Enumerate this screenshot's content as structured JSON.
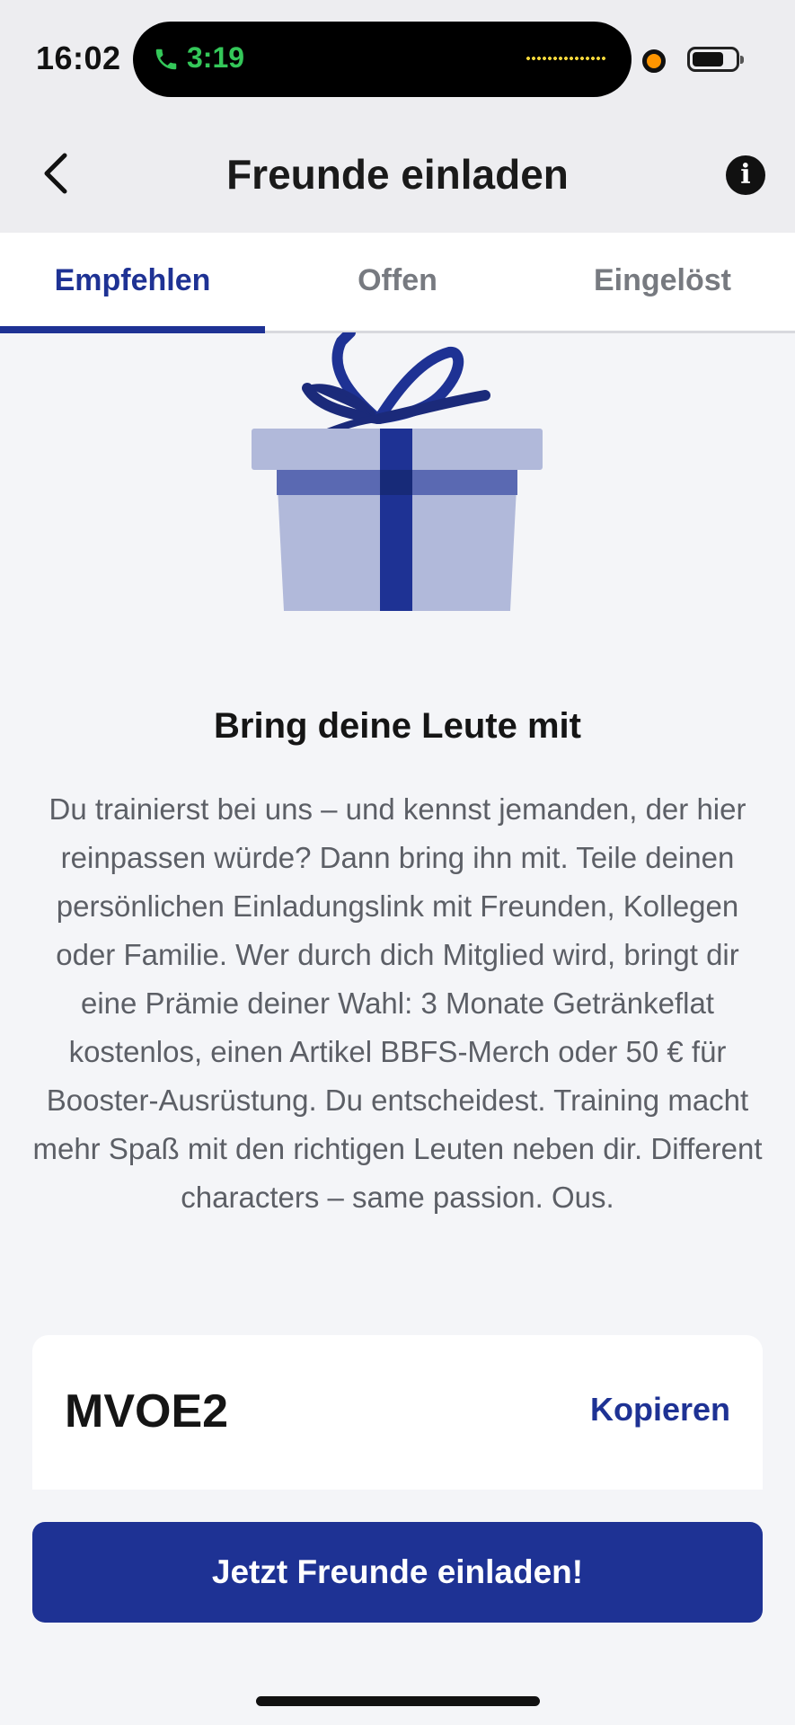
{
  "status_bar": {
    "time": "16:02",
    "call_timer": "3:19",
    "call_icon": "phone-icon",
    "battery_icon": "battery-icon",
    "mic_indicator_color": "#ff9500"
  },
  "nav": {
    "title": "Freunde einladen",
    "back_icon": "chevron-left-icon",
    "info_icon": "info-icon",
    "info_glyph": "i"
  },
  "tabs": [
    {
      "label": "Empfehlen",
      "active": true
    },
    {
      "label": "Offen",
      "active": false
    },
    {
      "label": "Eingelöst",
      "active": false
    }
  ],
  "content": {
    "illustration_icon": "gift-icon",
    "heading": "Bring deine Leute mit",
    "description": "Du trainierst bei uns – und kennst jemanden, der hier reinpassen würde? Dann bring ihn mit. Teile deinen persönlichen Einladungslink mit Freunden, Kollegen oder Familie. Wer durch dich Mitglied wird, bringt dir eine Prämie deiner Wahl: 3 Monate Getränkeflat kostenlos, einen Artikel BBFS-Merch oder 50 € für Booster-Ausrüstung. Du entscheidest. Training macht mehr Spaß mit den richtigen Leuten neben dir. Different characters – same passion. Ous."
  },
  "referral": {
    "code": "MVOE2",
    "copy_label": "Kopieren"
  },
  "cta": {
    "label": "Jetzt Freunde einladen!"
  },
  "colors": {
    "accent": "#1e3294",
    "background": "#f4f5f8",
    "header_background": "#ededf0",
    "call_green": "#34c759"
  }
}
